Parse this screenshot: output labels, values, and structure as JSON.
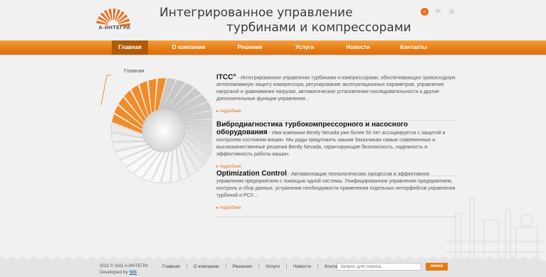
{
  "header": {
    "logo_text": "А-ИНТЕГРА",
    "headline_1": "Интегрированное управление",
    "headline_2": "турбинами и компрессорами",
    "icons": [
      "home-icon",
      "mail-icon",
      "sitemap-icon"
    ]
  },
  "nav": [
    {
      "label": "Главная",
      "active": true
    },
    {
      "label": "О компании",
      "active": false
    },
    {
      "label": "Решения",
      "active": false
    },
    {
      "label": "Услуги",
      "active": false
    },
    {
      "label": "Новости",
      "active": false
    },
    {
      "label": "Контакты",
      "active": false
    }
  ],
  "turbine": {
    "label": "Главная"
  },
  "articles": [
    {
      "title": "ITCC",
      "title_sup": "®",
      "desc": " - Интегрированное управление турбинами и компрессорами, обеспечивающее превосходную антипомпажную защиту компрессора, регулирование эксплуатационных параметров, управление нагрузкой и уравнивание нагрузки, автоматическое установление последовательности и другие дополнительные функции управления...",
      "more": "подробнее"
    },
    {
      "title": "Вибродиагностика турбокомпрессорного и насосного оборудования",
      "desc": " - Имя компании Bently Nevada уже более 50 лет ассоциируется с защитой и контролем состояния машин. Мы рады предложить нашим Заказчикам самые современные и высококачественные решения Bently Nevada, гарантирующие безопасность, надежность и эффективность работы машин.",
      "more": "подробнее"
    },
    {
      "title": "Optimization Control",
      "desc": " - Автоматизация технологических процессов и эффективное управление предприятием с помощью одной системы. Унифицированное управление предприятием, контроль и сбор данных, устранение необходимости применения отдельных интерфейсов управления турбиной и РСУ....",
      "more": "подробнее"
    }
  ],
  "footer": {
    "copyright": "2012 © ЗАО А-ИНТЕГРА",
    "developed_by": "Developed by ",
    "developer": "SIS",
    "links": [
      "Главная",
      "О компании",
      "Решения",
      "Услуги",
      "Новости",
      "Контакты"
    ],
    "search_placeholder": "Запрос для поиска...",
    "search_button": "поиск"
  },
  "colors": {
    "accent": "#e57b14",
    "accent_dark": "#b15a08",
    "background": "#f1f1f1"
  }
}
